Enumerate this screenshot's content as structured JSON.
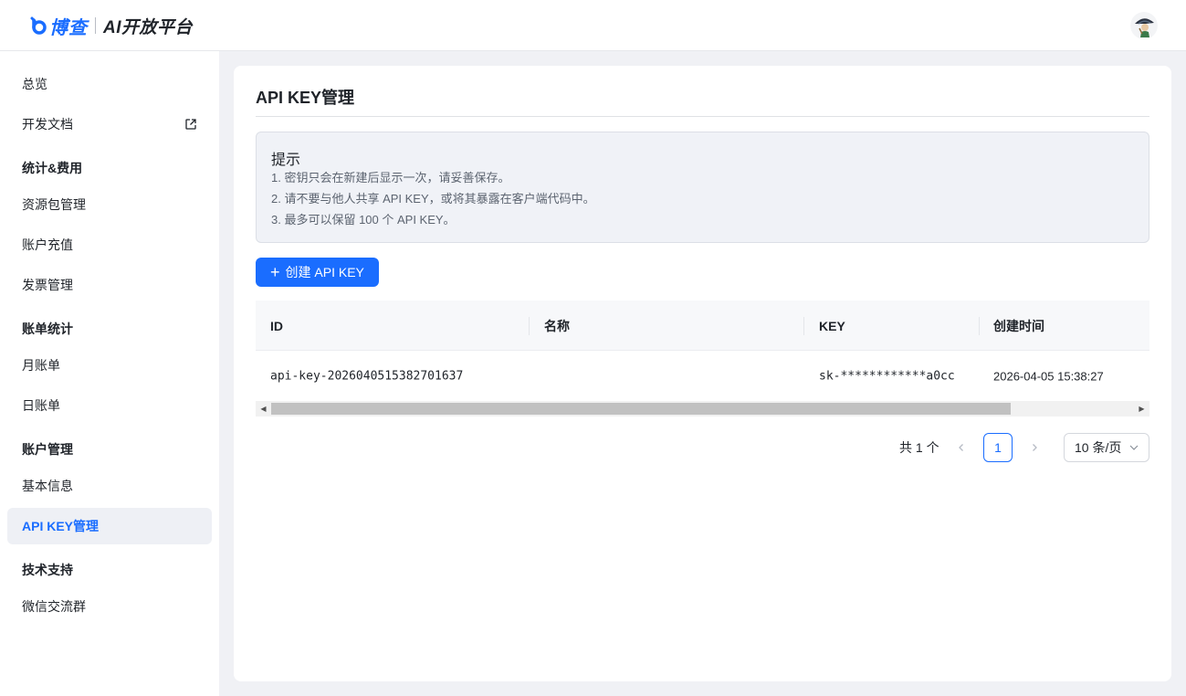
{
  "header": {
    "brand": "博查",
    "subtitle": "AI开放平台",
    "accent_color": "#1a6dff"
  },
  "sidebar": {
    "overview": "总览",
    "docs": "开发文档",
    "group_stats": "统计&费用",
    "resource_packages": "资源包管理",
    "recharge": "账户充值",
    "invoice": "发票管理",
    "group_bills": "账单统计",
    "monthly_bill": "月账单",
    "daily_bill": "日账单",
    "group_account": "账户管理",
    "basic_info": "基本信息",
    "api_key_mgmt": "API KEY管理",
    "group_support": "技术支持",
    "wechat_group": "微信交流群"
  },
  "main": {
    "title": "API KEY管理",
    "notice": {
      "title": "提示",
      "lines": [
        "1. 密钥只会在新建后显示一次，请妥善保存。",
        "2. 请不要与他人共享 API KEY，或将其暴露在客户端代码中。",
        "3. 最多可以保留 100 个 API KEY。"
      ]
    },
    "create_button": "创建 API KEY",
    "table": {
      "columns": [
        "ID",
        "名称",
        "KEY",
        "创建时间"
      ],
      "rows": [
        {
          "id": "api-key-2026040515382701637",
          "name": "",
          "key": "sk-************a0cc",
          "created": "2026-04-05 15:38:27"
        }
      ]
    },
    "pagination": {
      "total": "共 1 个",
      "current_page": "1",
      "page_size": "10 条/页"
    }
  }
}
